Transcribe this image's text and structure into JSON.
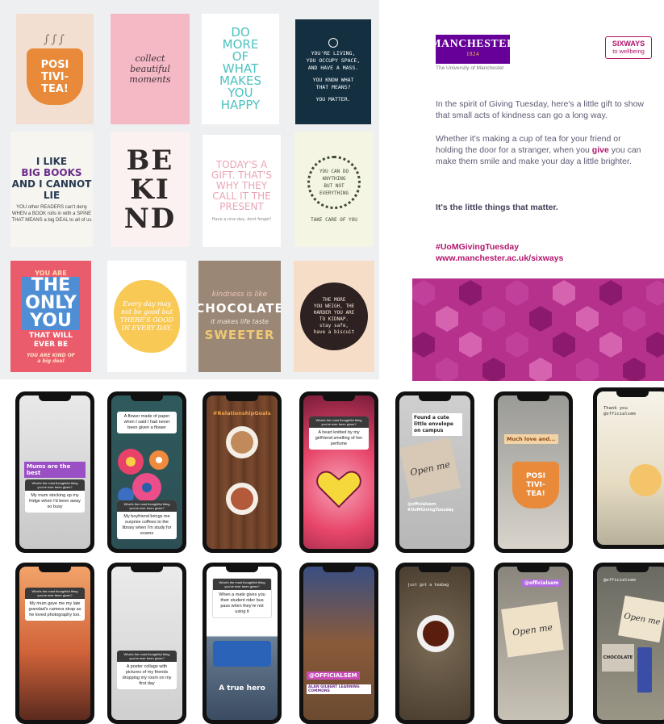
{
  "posters": {
    "positivi_tea": {
      "steam": "∫∫∫",
      "text": "POSI\nTIVI-\nTEA!"
    },
    "collect_moments": {
      "text": "collect\nbeautiful\nmoments"
    },
    "do_more": {
      "text": "DO\nMORE\nOF\nWHAT\nMAKES\nYOU\nHAPPY"
    },
    "youre_living": {
      "line1": "YOU'RE LIVING,\nYOU OCCUPY SPACE,\nAND HAVE A MASS.",
      "line2": "YOU KNOW WHAT\nTHAT MEANS?",
      "line3": "YOU MATTER."
    },
    "big_books": {
      "line1": "I LIKE",
      "line2": "BIG BOOKS",
      "line3": "AND I CANNOT LIE",
      "small": "YOU other READERS can't deny\nWHEN a BOOK rolls in with a SPINE\nTHAT MEANS a big DEAL to all of us"
    },
    "be_kind": {
      "letters": "BE\nKI\nND"
    },
    "todays_gift": {
      "text": "TODAY'S A\nGIFT. THAT'S\nWHY THEY\nCALL IT THE\nPRESENT",
      "small": "Have a nice day, dont forget!"
    },
    "you_can_do": {
      "text": "YOU CAN DO\nANYTHING\nBUT NOT\nEVERYTHING",
      "caption": "TAKE CARE OF YOU"
    },
    "only_you": {
      "a": "YOU ARE",
      "b": "THE\nONLY\nYOU",
      "c": "THAT WILL\nEVER BE",
      "d": "YOU ARE KIND OF\na big deal"
    },
    "every_day": {
      "text": "Every day may\nnot be good but\nTHERE'S GOOD\nIN EVERY DAY."
    },
    "chocolate": {
      "a": "kindness is like",
      "b": "CHOCOLATE",
      "c": "it makes life taste",
      "d": "SWEETER"
    },
    "the_more": {
      "text": "THE MORE\nYOU WEIGH, THE\nHARDER YOU ARE\nTO KIDNAP.\nstay safe,\nhave a biscuit"
    }
  },
  "card": {
    "logo_uom": "MANCHESTER",
    "logo_est": "1824",
    "logo_sub": "The University of Manchester",
    "logo_six_1": "SIXWAYS",
    "logo_six_2": "to wellbeing",
    "para1": "In the spirit of Giving Tuesday, here's a little gift to show that small acts of kindness can go a long way.",
    "para2_a": "Whether it's making a cup of tea for your friend or holding the door for a stranger, when you ",
    "para2_give": "give",
    "para2_b": " you can make them smile and make your day a little brighter.",
    "tagline": "It's the little things that matter.",
    "hashtag": "#UoMGivingTuesday",
    "url": "www.manchester.ac.uk/sixways",
    "colors": {
      "purple": "#660099",
      "magenta": "#b3146c",
      "hex_base": "#b5318c"
    }
  },
  "stories": {
    "s1": {
      "sticker": "Mums are the best",
      "question": "What's the most thoughtful thing you've ever been given?",
      "answer": "My mum stocking up my fridge when I'd been away so busy"
    },
    "s2": {
      "question": "What's the most thoughtful thing you've ever been given?",
      "answer1": "A flower made of paper when I said I had never been given a flower",
      "answer2": "My boyfriend brings me surprise coffees to the library when I'm study for exams"
    },
    "s3": {
      "hashtag": "#RelationshipGoals"
    },
    "s4": {
      "question": "What's the most thoughtful thing you've ever been given?",
      "answer": "A heart knitted by my girlfriend smelling of her perfume"
    },
    "s5": {
      "sticker": "Found a cute little envelope on campus",
      "card_text": "Open me",
      "tag": "@officialsem #UoMGivingTuesday"
    },
    "s6": {
      "sticker": "Much love and...",
      "mug_text": "POSI\nTIVI-\nTEA!"
    },
    "s7": {
      "header": "Thank you @officialsem"
    },
    "s8": {
      "question": "What's the most thoughtful thing you've ever been given?",
      "answer": "My mum gave me my late grandad's camera strap as he loved photography too."
    },
    "s9": {
      "question": "What's the most thoughtful thing you've ever been given?",
      "answer": "A poster collage with pictures of my friends dropping my room on my first day"
    },
    "s10": {
      "question": "What's the most thoughtful thing you've ever been given?",
      "answer": "When a mate gives you their student rider bus pass when they're not using it",
      "caption": "A true hero"
    },
    "s11": {
      "sticker": "@OFFICIALSEM",
      "caption": "ALAN GILBERT LEARNING COMMONS"
    },
    "s12": {
      "caption": "just got a teabag"
    },
    "s13": {
      "sticker": "@officialsem",
      "card_text": "Open me"
    },
    "s14": {
      "header": "@officialsem",
      "card_text": "Open me",
      "sticker": "CHOCOLATE"
    }
  }
}
